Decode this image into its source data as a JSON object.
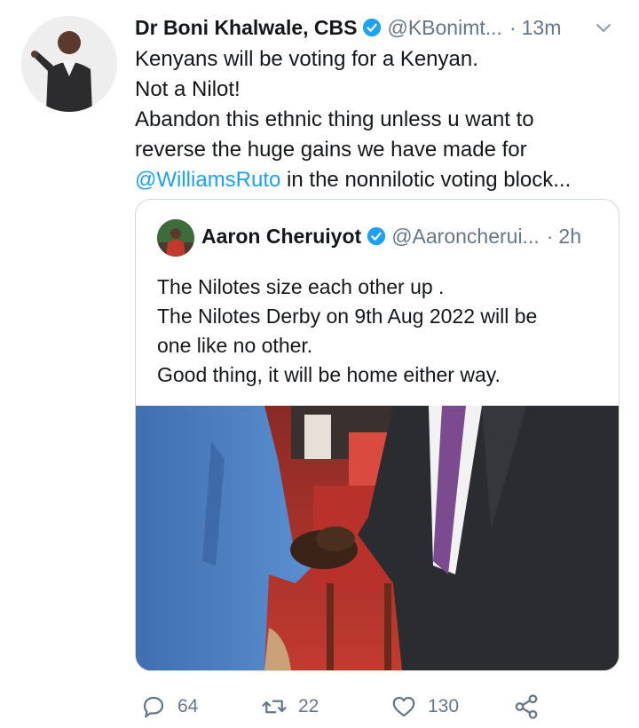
{
  "tweet": {
    "author_name": "Dr Boni Khalwale, CBS",
    "author_handle": "@KBonimt...",
    "separator": "·",
    "time": "13m",
    "lines": [
      "Kenyans will be voting for a Kenyan.",
      "Not a Nilot!",
      "Abandon this ethnic thing unless u want to",
      "reverse the huge gains we have made for"
    ],
    "mention": "@WilliamsRuto",
    "last_line_rest": " in the nonnilotic voting block..."
  },
  "quoted_tweet": {
    "author_name": "Aaron Cheruiyot",
    "author_handle": "@Aaroncherui...",
    "separator": "·",
    "time": "2h",
    "lines": [
      "The Nilotes size each other up .",
      "The Nilotes Derby on 9th Aug 2022 will be",
      "one like no other.",
      "Good thing, it will be home either way."
    ]
  },
  "actions": {
    "reply_count": "64",
    "retweet_count": "22",
    "like_count": "130"
  },
  "colors": {
    "link": "#1da1f2",
    "verified": "#1da1f2",
    "muted": "#657786"
  },
  "icons": [
    "verified-badge-icon",
    "chevron-down-icon",
    "reply-icon",
    "retweet-icon",
    "like-icon",
    "share-icon"
  ]
}
